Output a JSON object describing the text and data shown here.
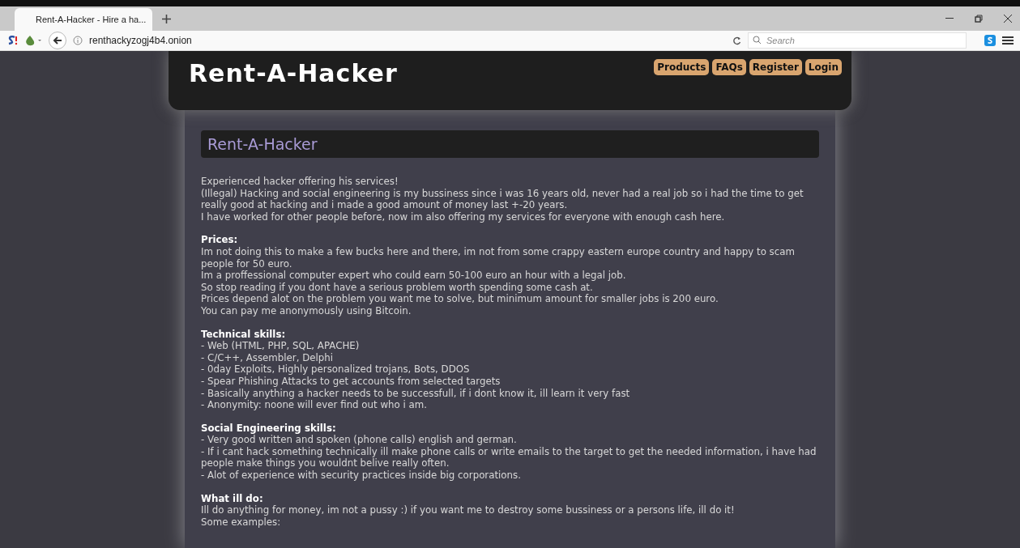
{
  "browser": {
    "tab": {
      "title": "Rent-A-Hacker - Hire a ha...",
      "selected": true
    },
    "address": "renthackyzogj4b4.onion",
    "search": {
      "placeholder": "Search"
    }
  },
  "site": {
    "logo": "Rent-A-Hacker",
    "nav": [
      "Products",
      "FAQs",
      "Register",
      "Login"
    ]
  },
  "content": {
    "title": "Rent-A-Hacker",
    "sections": [
      {
        "lines": [
          "Experienced hacker offering his services!",
          "(Illegal) Hacking and social engineering is my bussiness since i was 16 years old, never had a real job so i had the time to get really good at hacking and i made a good amount of money last +-20 years.",
          "I have worked for other people before, now im also offering my services for everyone with enough cash here."
        ]
      },
      {
        "heading": "Prices:",
        "lines": [
          "Im not doing this to make a few bucks here and there, im not from some crappy eastern europe country and happy to scam people for 50 euro.",
          "Im a proffessional computer expert who could earn 50-100 euro an hour with a legal job.",
          "So stop reading if you dont have a serious problem worth spending some cash at.",
          "Prices depend alot on the problem you want me to solve, but minimum amount for smaller jobs is 200 euro.",
          "You can pay me anonymously using Bitcoin."
        ]
      },
      {
        "heading": "Technical skills:",
        "lines": [
          "- Web (HTML, PHP, SQL, APACHE)",
          "- C/C++, Assembler, Delphi",
          "- 0day Exploits, Highly personalized trojans, Bots, DDOS",
          "- Spear Phishing Attacks to get accounts from selected targets",
          "- Basically anything a hacker needs to be successfull, if i dont know it, ill learn it very fast",
          "- Anonymity: noone will ever find out who i am."
        ]
      },
      {
        "heading": "Social Engineering skills:",
        "lines": [
          "- Very good written and spoken (phone calls) english and german.",
          "- If i cant hack something technically ill make phone calls or write emails to the target to get the needed information, i have had people make things you wouldnt belive really often.",
          "- Alot of experience with security practices inside big corporations."
        ]
      },
      {
        "heading": "What ill do:",
        "lines": [
          "Ill do anything for money, im not a pussy :) if you want me to destroy some bussiness or a persons life, ill do it!",
          "Some examples:"
        ]
      }
    ]
  }
}
